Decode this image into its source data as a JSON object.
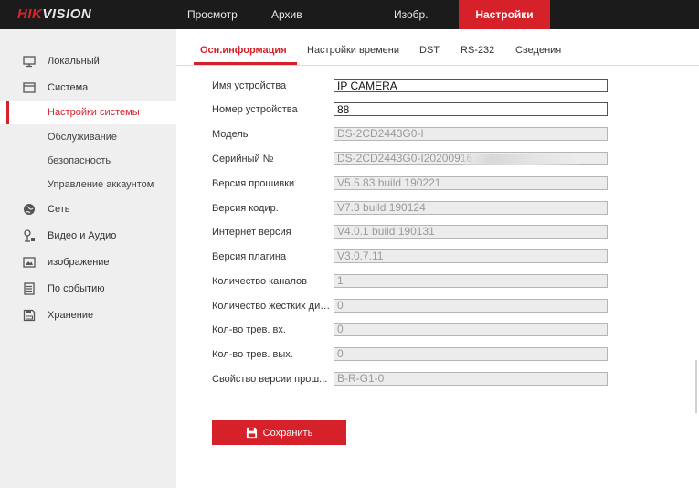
{
  "brand": {
    "part1": "HIK",
    "part2": "VISION"
  },
  "top_nav": [
    {
      "label": "Просмотр",
      "active": false
    },
    {
      "label": "Архив",
      "active": false
    },
    {
      "label": "Изобр.",
      "active": false
    },
    {
      "label": "Настройки",
      "active": true
    }
  ],
  "sidebar": {
    "items": [
      {
        "label": "Локальный",
        "icon": "monitor-icon"
      },
      {
        "label": "Система",
        "icon": "system-icon"
      },
      {
        "label": "Настройки системы",
        "sub": true,
        "active": true
      },
      {
        "label": "Обслуживание",
        "sub": true
      },
      {
        "label": "безопасность",
        "sub": true
      },
      {
        "label": "Управление аккаунтом",
        "sub": true
      },
      {
        "label": "Сеть",
        "icon": "globe-icon"
      },
      {
        "label": "Видео и Аудио",
        "icon": "video-audio-icon"
      },
      {
        "label": "изображение",
        "icon": "image-icon"
      },
      {
        "label": "По событию",
        "icon": "event-icon"
      },
      {
        "label": "Хранение",
        "icon": "storage-icon"
      }
    ]
  },
  "tabs": [
    {
      "label": "Осн.информация",
      "active": true
    },
    {
      "label": "Настройки времени"
    },
    {
      "label": "DST"
    },
    {
      "label": "RS-232"
    },
    {
      "label": "Сведения"
    }
  ],
  "form": {
    "rows": [
      {
        "label": "Имя устройства",
        "value": "IP CAMERA",
        "editable": true
      },
      {
        "label": "Номер устройства",
        "value": "88",
        "editable": true
      },
      {
        "label": "Модель",
        "value": "DS-2CD2443G0-I",
        "editable": false
      },
      {
        "label": "Серийный №",
        "value": "DS-2CD2443G0-I20200916",
        "editable": false
      },
      {
        "label": "Версия прошивки",
        "value": "V5.5.83 build 190221",
        "editable": false
      },
      {
        "label": "Версия кодир.",
        "value": "V7.3 build 190124",
        "editable": false
      },
      {
        "label": "Интернет версия",
        "value": "V4.0.1 build 190131",
        "editable": false
      },
      {
        "label": "Версия плагина",
        "value": "V3.0.7.11",
        "editable": false
      },
      {
        "label": "Количество каналов",
        "value": "1",
        "editable": false
      },
      {
        "label": "Количество жестких дис...",
        "value": "0",
        "editable": false
      },
      {
        "label": "Кол-во трев. вх.",
        "value": "0",
        "editable": false
      },
      {
        "label": "Кол-во трев. вых.",
        "value": "0",
        "editable": false
      },
      {
        "label": "Свойство версии прош...",
        "value": "B-R-G1-0",
        "editable": false
      }
    ]
  },
  "save_button": {
    "label": "Сохранить",
    "icon": "save-icon"
  },
  "colors": {
    "accent": "#d6202a",
    "topbar": "#1b1b1b",
    "sidebar": "#efefef"
  }
}
